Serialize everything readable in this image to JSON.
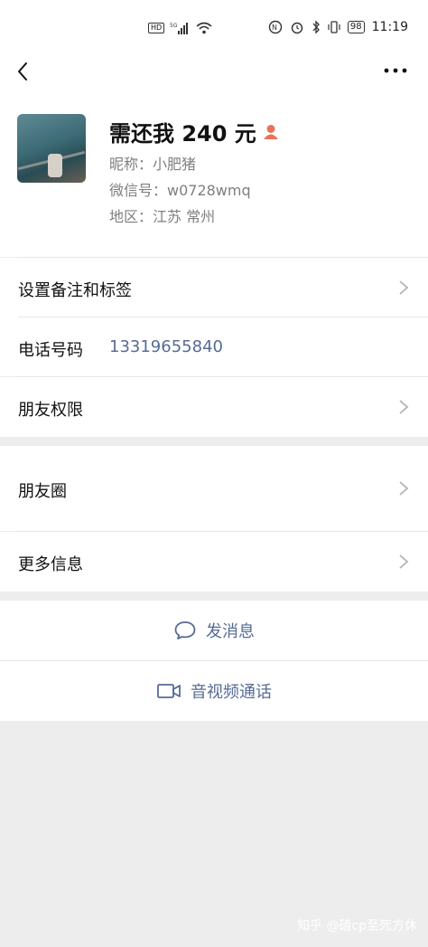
{
  "status_bar": {
    "network_chip": "HD",
    "network_gen": "5G",
    "battery": "98",
    "time": "11:19"
  },
  "profile": {
    "name": "需还我 240 元",
    "nickname": "昵称：小肥猪",
    "wechat_id": "微信号：w0728wmq",
    "region": "地区：江苏  常州"
  },
  "section1": {
    "remark_label": "设置备注和标签",
    "phone_label": "电话号码",
    "phone_value": "13319655840",
    "permission_label": "朋友权限"
  },
  "section2": {
    "moments_label": "朋友圈",
    "more_info_label": "更多信息"
  },
  "actions": {
    "message": "发消息",
    "call": "音视频通话"
  },
  "watermark": "知乎 @磕cp至死方休",
  "colors": {
    "link": "#576b95",
    "gender_icon": "#e8735a",
    "background": "#ededed"
  }
}
